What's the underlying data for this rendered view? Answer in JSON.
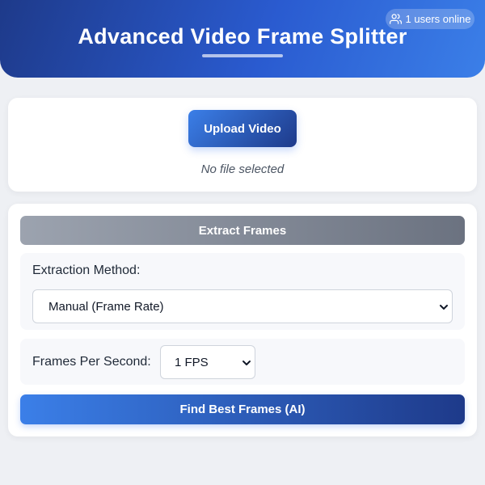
{
  "header": {
    "title": "Advanced Video Frame Splitter",
    "users_online": "1 users online",
    "users_icon": "users-icon"
  },
  "upload": {
    "button_label": "Upload Video",
    "file_status": "No file selected"
  },
  "extract": {
    "button_label": "Extract Frames",
    "method_label": "Extraction Method:",
    "method_value": "Manual (Frame Rate)",
    "fps_label": "Frames Per Second:",
    "fps_value": "1 FPS",
    "ai_button_label": "Find Best Frames (AI)"
  },
  "colors": {
    "primary_blue": "#2563eb",
    "dark_blue": "#1e3a8a",
    "disabled_gray": "#6b7280",
    "background": "#eef0f4"
  }
}
